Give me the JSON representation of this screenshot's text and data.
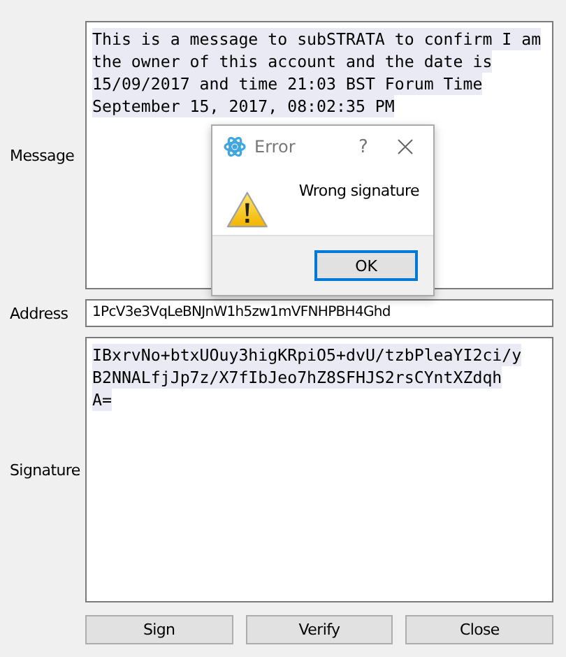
{
  "form": {
    "message": {
      "label": "Message",
      "lines": [
        "This is a message to subSTRATA to confirm I am",
        "the owner of this account and the date is",
        "15/09/2017 and time 21:03 BST Forum Time",
        "September 15, 2017, 08:02:35 PM"
      ]
    },
    "address": {
      "label": "Address",
      "value": "1PcV3e3VqLeBNJnW1h5zw1mVFNHPBH4Ghd"
    },
    "signature": {
      "label": "Signature",
      "lines": [
        "IBxrvNo+btxUOuy3higKRpiO5+dvU/tzbPleaYI2ci/y",
        "B2NNALfjJp7z/X7fIbJeo7hZ8SFHJS2rsCYntXZdqh",
        "A="
      ]
    }
  },
  "buttons": [
    {
      "label": "Sign"
    },
    {
      "label": "Verify"
    },
    {
      "label": "Close"
    }
  ],
  "dialog": {
    "title": "Error",
    "help": "?",
    "message": "Wrong signature",
    "button": {
      "label": "OK",
      "focused": true
    }
  }
}
